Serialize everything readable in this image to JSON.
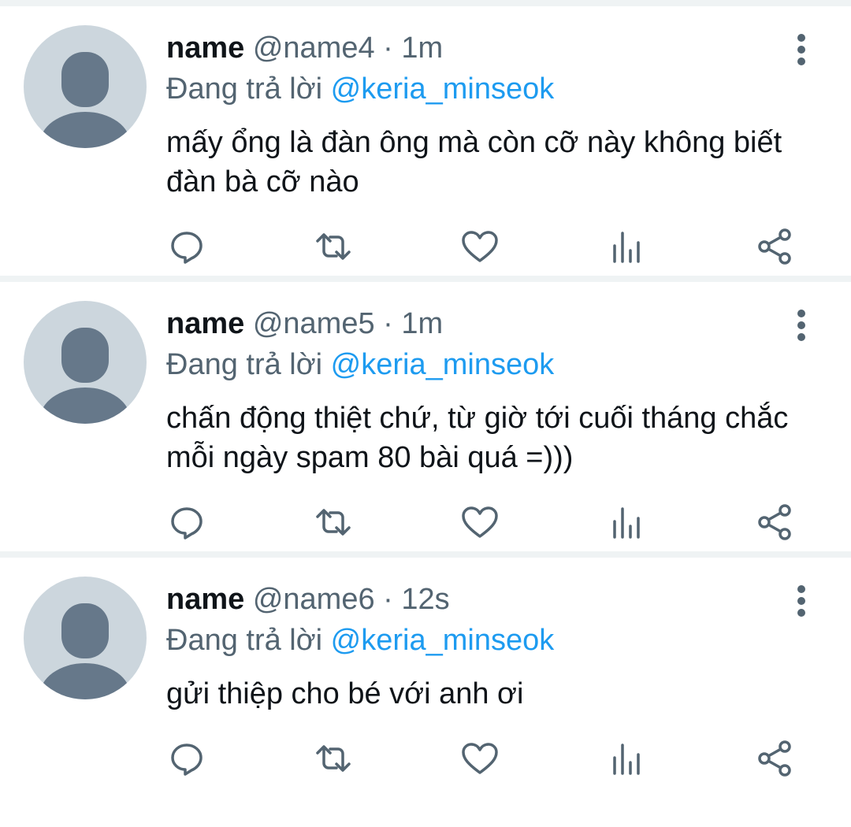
{
  "colors": {
    "accent": "#1d9bf0",
    "secondary_text": "#536471",
    "primary_text": "#0f1419",
    "avatar_bg": "#ccd6dd",
    "avatar_fg": "#66788a"
  },
  "icons": {
    "reply": "speech-bubble-icon",
    "retweet": "retweet-icon",
    "like": "heart-icon",
    "views": "bar-chart-icon",
    "share": "share-icon",
    "more": "vertical-dots-icon"
  },
  "tweets": [
    {
      "name": "name",
      "handle": "@name4",
      "separator": "·",
      "time": "1m",
      "replying_prefix": "Đang trả lời",
      "replying_to": "@keria_minseok",
      "text": "mấy ổng là đàn ông mà còn cỡ này không biết đàn bà cỡ nào"
    },
    {
      "name": "name",
      "handle": "@name5",
      "separator": "·",
      "time": "1m",
      "replying_prefix": "Đang trả lời",
      "replying_to": "@keria_minseok",
      "text": "chấn động thiệt chứ, từ giờ tới cuối tháng chắc mỗi ngày spam 80 bài quá =)))"
    },
    {
      "name": "name",
      "handle": "@name6",
      "separator": "·",
      "time": "12s",
      "replying_prefix": "Đang trả lời",
      "replying_to": "@keria_minseok",
      "text": "gửi thiệp cho bé với anh ơi"
    }
  ]
}
